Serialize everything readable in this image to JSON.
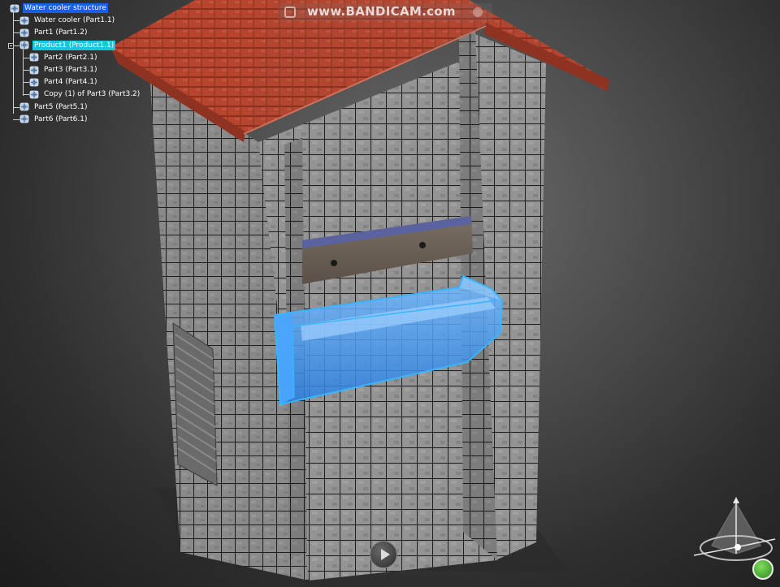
{
  "watermark": {
    "text": "www.BANDICAM.com"
  },
  "spec_tree": {
    "items": [
      {
        "label": "Water cooler structure",
        "level": 0,
        "expanded": true,
        "selected": "root"
      },
      {
        "label": "Water cooler (Part1.1)",
        "level": 1
      },
      {
        "label": "Part1 (Part1.2)",
        "level": 1
      },
      {
        "label": "Product1 (Product1.1)",
        "level": 1,
        "expanded": true,
        "selected": "highlight"
      },
      {
        "label": "Part2 (Part2.1)",
        "level": 2
      },
      {
        "label": "Part3 (Part3.1)",
        "level": 2
      },
      {
        "label": "Part4 (Part4.1)",
        "level": 2
      },
      {
        "label": "Copy (1) of Part3 (Part3.2)",
        "level": 2
      },
      {
        "label": "Part5 (Part5.1)",
        "level": 1
      },
      {
        "label": "Part6 (Part6.1)",
        "level": 1
      }
    ]
  },
  "colors": {
    "roof": "#b6452f",
    "wall_tile": "#8a8a8a",
    "grout": "#1e1e1e",
    "selection_blue": "#2c9cff",
    "bracket": "#6c6358",
    "tree_root_highlight": "#1a5ee6",
    "tree_selected_highlight": "#19c7dd"
  },
  "icons": {
    "tree_node": "product-gear-icon",
    "compass": "3d-compass-icon",
    "play": "play-icon",
    "brand": "3ds-logo-icon"
  }
}
